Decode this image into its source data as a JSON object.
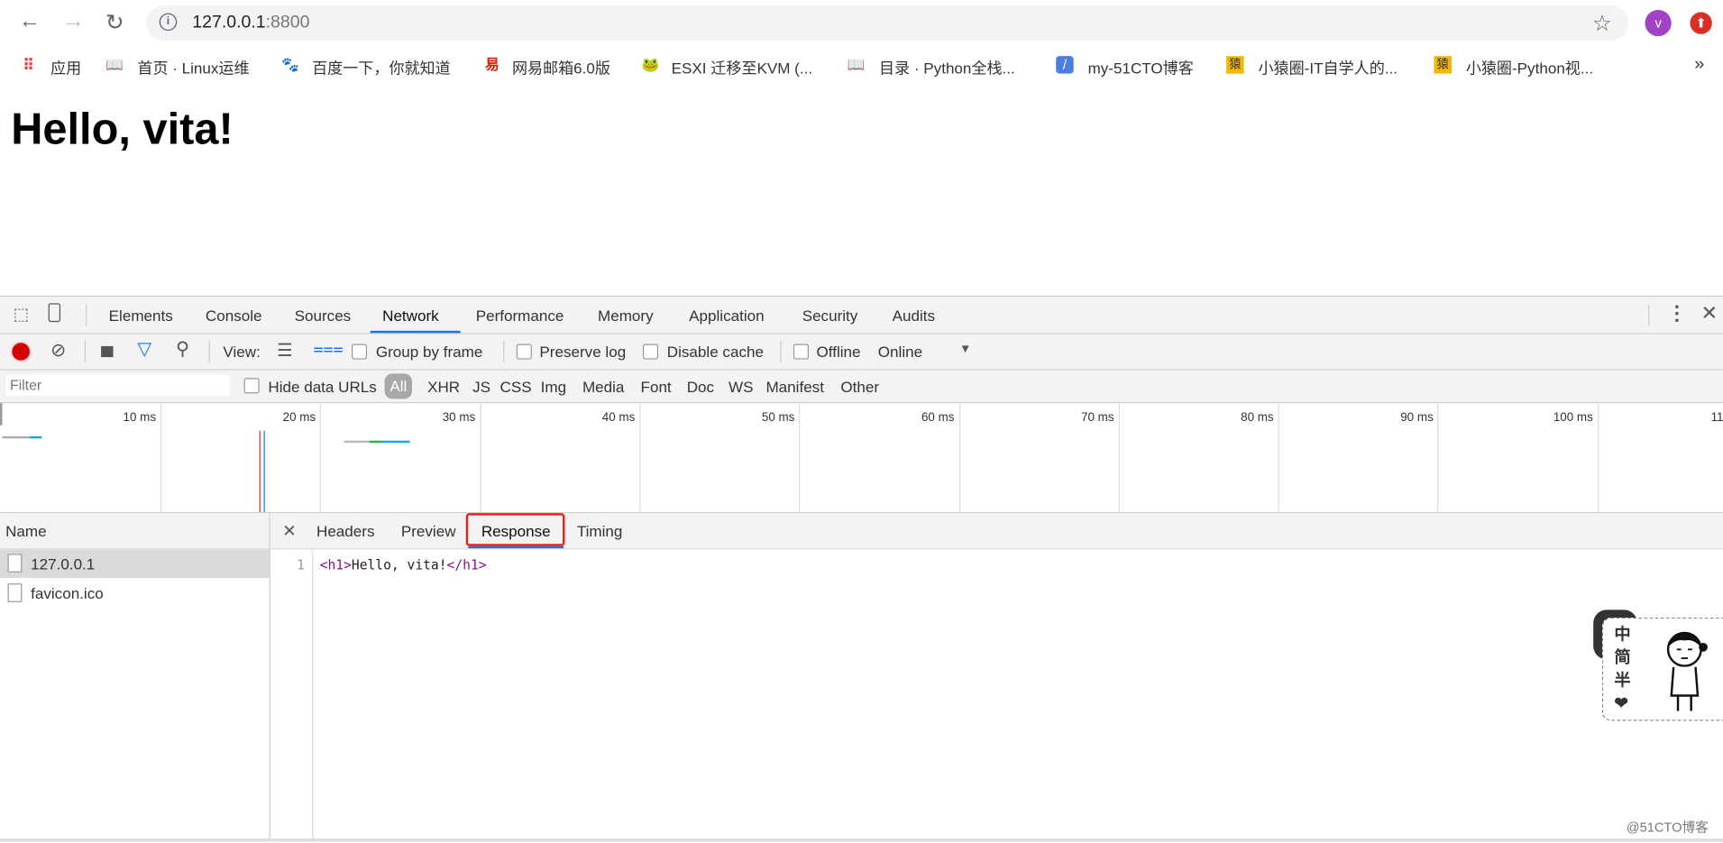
{
  "browser": {
    "url_host": "127.0.0.1",
    "url_port": ":8800",
    "avatar_letter": "v",
    "bookmarks": [
      {
        "label": "应用",
        "icon": "apps-grid-icon"
      },
      {
        "label": "首页 · Linux运维",
        "icon": "book-icon"
      },
      {
        "label": "百度一下，你就知道",
        "icon": "baidu-paw-icon"
      },
      {
        "label": "网易邮箱6.0版",
        "icon": "netease-mail-icon"
      },
      {
        "label": "ESXI 迁移至KVM (...",
        "icon": "frog-icon"
      },
      {
        "label": "目录 · Python全栈...",
        "icon": "book-icon"
      },
      {
        "label": "my-51CTO博客",
        "icon": "feather-icon"
      },
      {
        "label": "小猿圈-IT自学人的...",
        "icon": "yuan-icon"
      },
      {
        "label": "小猿圈-Python视...",
        "icon": "yuan-icon"
      }
    ],
    "overflow": "»"
  },
  "page": {
    "heading": "Hello, vita!"
  },
  "devtools": {
    "tabs": [
      "Elements",
      "Console",
      "Sources",
      "Network",
      "Performance",
      "Memory",
      "Application",
      "Security",
      "Audits"
    ],
    "active_tab": "Network",
    "toolbar": {
      "view_label": "View:",
      "group_by_frame": "Group by frame",
      "preserve_log": "Preserve log",
      "disable_cache": "Disable cache",
      "offline": "Offline",
      "throttling": "Online"
    },
    "filter": {
      "placeholder": "Filter",
      "hide_data_urls": "Hide data URLs",
      "types": [
        "All",
        "XHR",
        "JS",
        "CSS",
        "Img",
        "Media",
        "Font",
        "Doc",
        "WS",
        "Manifest",
        "Other"
      ],
      "active_type": "All"
    },
    "overview": {
      "tick_labels": [
        "10 ms",
        "20 ms",
        "30 ms",
        "40 ms",
        "50 ms",
        "60 ms",
        "70 ms",
        "80 ms",
        "90 ms",
        "100 ms",
        "11"
      ]
    },
    "requests": {
      "header": "Name",
      "items": [
        "127.0.0.1",
        "favicon.ico"
      ],
      "selected": "127.0.0.1"
    },
    "details": {
      "tabs": [
        "Headers",
        "Preview",
        "Response",
        "Timing"
      ],
      "active_tab": "Response",
      "line_number": "1",
      "code": {
        "open_tag": "<h1>",
        "text": "Hello, vita!",
        "close_tag": "</h1>"
      }
    }
  },
  "sticker": {
    "chars": [
      "中",
      "简",
      "半",
      "❤"
    ]
  },
  "watermark": "@51CTO博客",
  "colors": {
    "accent": "#1a73e8",
    "record": "#d50000",
    "highlight_box": "#e8211b",
    "tag": "#881280"
  }
}
